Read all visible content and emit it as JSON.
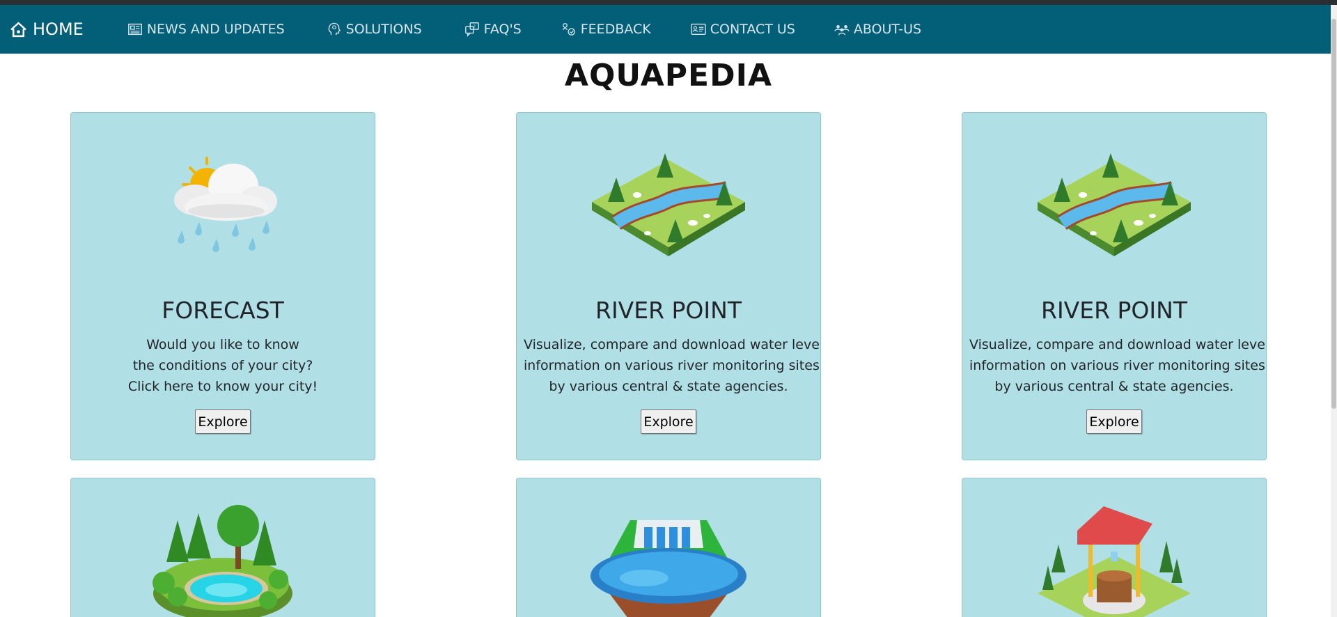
{
  "nav": {
    "home": "HOME",
    "items": [
      {
        "label": "NEWS AND UPDATES",
        "icon": "newspaper-icon"
      },
      {
        "label": "SOLUTIONS",
        "icon": "lightbulb-head-icon"
      },
      {
        "label": "FAQ'S",
        "icon": "chat-bubbles-icon"
      },
      {
        "label": "FEEDBACK",
        "icon": "feedback-icon"
      },
      {
        "label": "CONTACT US",
        "icon": "contact-card-icon"
      },
      {
        "label": "ABOUT-US",
        "icon": "team-icon"
      }
    ]
  },
  "page": {
    "title": "AQUAPEDIA"
  },
  "cards": [
    {
      "title": "FORECAST",
      "desc": [
        "Would you like to know",
        "the conditions of your city?",
        "Click here to know your city!"
      ],
      "button": "Explore",
      "icon": "sun-cloud-rain-icon"
    },
    {
      "title": "RIVER POINT",
      "desc": [
        "Visualize, compare and download water level",
        "information on various river monitoring sites",
        "by various central & state agencies."
      ],
      "button": "Explore",
      "icon": "river-landscape-icon"
    },
    {
      "title": "RIVER POINT",
      "desc": [
        "Visualize, compare and download water level",
        "information on various river monitoring sites",
        "by various central & state agencies."
      ],
      "button": "Explore",
      "icon": "river-landscape-icon"
    },
    {
      "icon": "pond-forest-icon"
    },
    {
      "icon": "dam-reservoir-icon"
    },
    {
      "icon": "water-well-icon"
    }
  ],
  "colors": {
    "navbar": "#035f78",
    "card": "#b0e0e6",
    "nav_text": "#d6e6ec"
  }
}
